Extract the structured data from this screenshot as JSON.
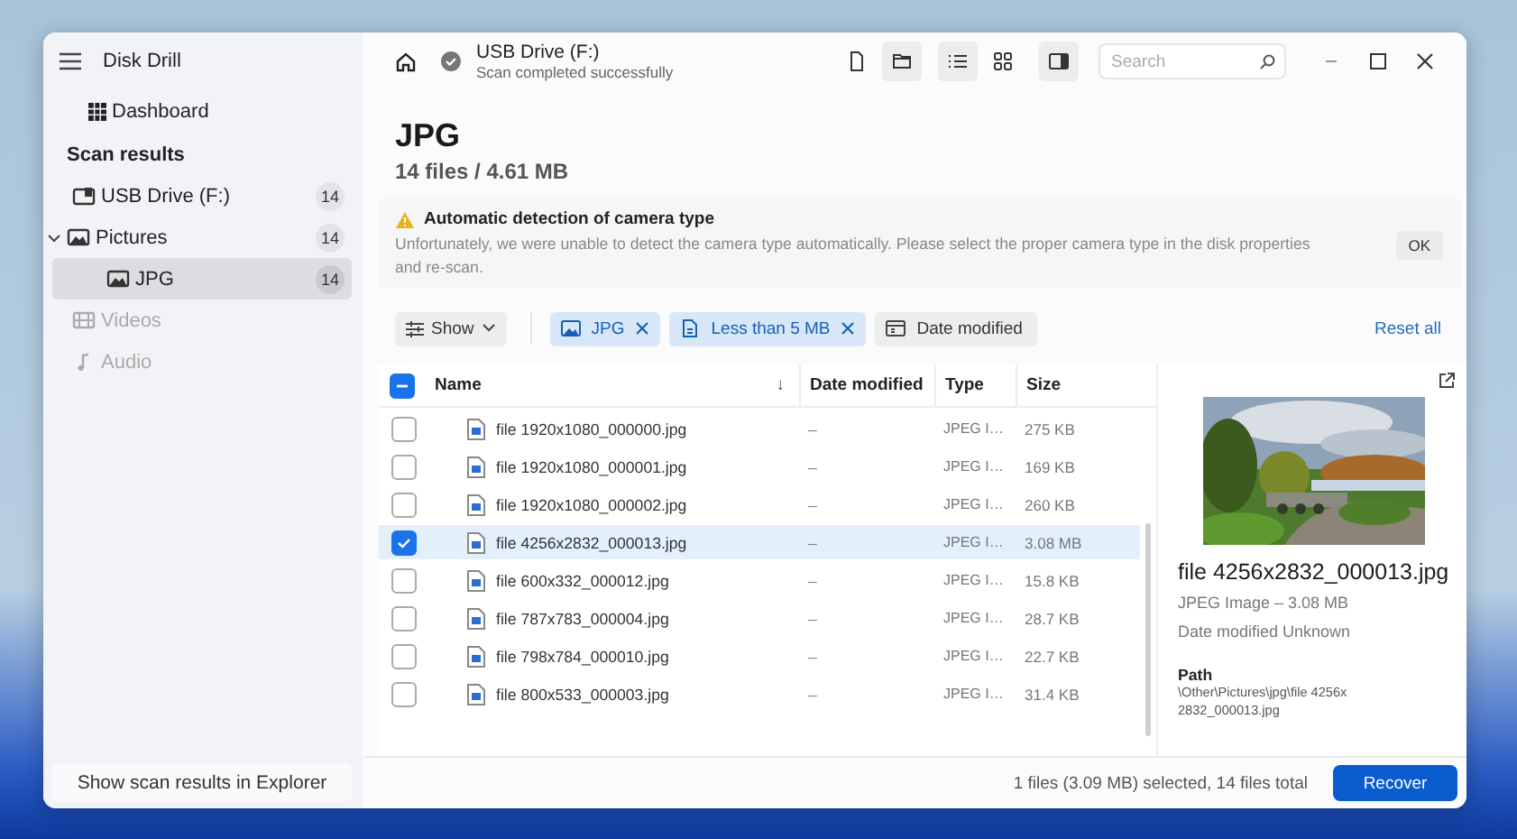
{
  "window": {
    "app_title": "Disk Drill"
  },
  "sidebar": {
    "dashboard": "Dashboard",
    "section_title": "Scan results",
    "tree": [
      {
        "kind": "drive",
        "label": "USB Drive (F:)",
        "count": "14",
        "selected": false,
        "disabled": false
      },
      {
        "kind": "images",
        "label": "Pictures",
        "count": "14",
        "selected": false,
        "disabled": false,
        "expanded": true,
        "children": [
          {
            "kind": "images",
            "label": "JPG",
            "count": "14",
            "selected": true,
            "disabled": false
          }
        ]
      },
      {
        "kind": "videos",
        "label": "Videos",
        "selected": false,
        "disabled": true
      },
      {
        "kind": "audio",
        "label": "Audio",
        "selected": false,
        "disabled": true
      }
    ],
    "explorer_button": "Show scan results in Explorer"
  },
  "topbar": {
    "location": "USB Drive (F:)",
    "status": "Scan completed successfully",
    "search": {
      "placeholder": "Search"
    }
  },
  "content": {
    "title": "JPG",
    "subtitle": "14 files / 4.61 MB",
    "alert": {
      "title": "Automatic detection of camera type",
      "message": "Unfortunately, we were unable to detect the camera type automatically. Please select the proper camera type in the disk properties and re-scan.",
      "button": "OK"
    },
    "filters": {
      "show": "Show",
      "chips": [
        {
          "kind": "type",
          "label": "JPG",
          "active": true
        },
        {
          "kind": "size",
          "label": "Less than 5 MB",
          "active": true
        },
        {
          "kind": "date",
          "label": "Date modified",
          "active": false
        }
      ],
      "reset": "Reset all"
    }
  },
  "table": {
    "select_all": {
      "checked": true,
      "partial": true
    },
    "sort_mark": "↓",
    "columns": [
      "Name",
      "Date modified",
      "Type",
      "Size"
    ],
    "rows": [
      {
        "name": "file 1920x1080_000000.jpg",
        "date": "–",
        "type": "JPEG I…",
        "size": "275 KB",
        "checked": false,
        "selected": false
      },
      {
        "name": "file 1920x1080_000001.jpg",
        "date": "–",
        "type": "JPEG I…",
        "size": "169 KB",
        "checked": false,
        "selected": false
      },
      {
        "name": "file 1920x1080_000002.jpg",
        "date": "–",
        "type": "JPEG I…",
        "size": "260 KB",
        "checked": false,
        "selected": false
      },
      {
        "name": "file 4256x2832_000013.jpg",
        "date": "–",
        "type": "JPEG I…",
        "size": "3.08 MB",
        "checked": true,
        "selected": true
      },
      {
        "name": "file 600x332_000012.jpg",
        "date": "–",
        "type": "JPEG I…",
        "size": "15.8 KB",
        "checked": false,
        "selected": false
      },
      {
        "name": "file 787x783_000004.jpg",
        "date": "–",
        "type": "JPEG I…",
        "size": "28.7 KB",
        "checked": false,
        "selected": false
      },
      {
        "name": "file 798x784_000010.jpg",
        "date": "–",
        "type": "JPEG I…",
        "size": "22.7 KB",
        "checked": false,
        "selected": false
      },
      {
        "name": "file 800x533_000003.jpg",
        "date": "–",
        "type": "JPEG I…",
        "size": "31.4 KB",
        "checked": false,
        "selected": false
      }
    ]
  },
  "preview": {
    "kind": "picture",
    "title": "file 4256x2832_000013.jpg",
    "meta": "JPEG Image – 3.08 MB",
    "date": "Date modified Unknown",
    "path_label": "Path",
    "path": "\\Other\\Pictures\\jpg\\file 4256x2832_000013.jpg"
  },
  "footer": {
    "status": "1 files (3.09 MB) selected, 14 files total",
    "button": "Recover"
  }
}
